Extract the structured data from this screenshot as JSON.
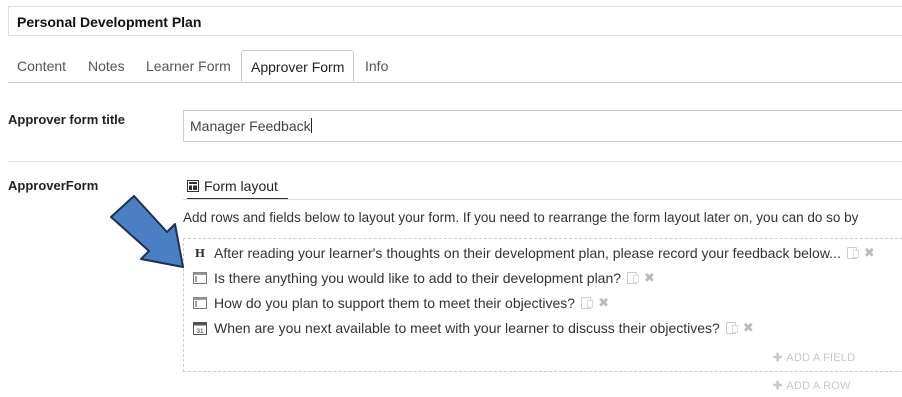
{
  "header": {
    "title": "Personal Development Plan"
  },
  "tabs": [
    {
      "label": "Content"
    },
    {
      "label": "Notes"
    },
    {
      "label": "Learner Form"
    },
    {
      "label": "Approver Form",
      "active": true
    },
    {
      "label": "Info"
    }
  ],
  "approver_title": {
    "label": "Approver form title",
    "value": "Manager Feedback"
  },
  "approver_form": {
    "label": "ApproverForm",
    "layout_tab": "Form layout",
    "help_text": "Add rows and fields below to layout your form. If you need to rearrange the form layout later on, you can do so by",
    "rows": [
      {
        "icon": "heading-icon",
        "text": "After reading your learner's thoughts on their development plan, please record your feedback below..."
      },
      {
        "icon": "textarea-icon",
        "text": "Is there anything you would like to add to their development plan?"
      },
      {
        "icon": "textarea-icon",
        "text": "How do you plan to support them to meet their objectives?"
      },
      {
        "icon": "calendar-icon",
        "text": "When are you next available to meet with your learner to discuss their objectives?",
        "calendar_day": "31"
      }
    ],
    "heading_glyph": "H",
    "add_field": "ADD A FIELD",
    "add_row": "ADD A ROW"
  },
  "colors": {
    "arrow_fill": "#4a7fc4",
    "arrow_stroke": "#1f2f4d"
  }
}
